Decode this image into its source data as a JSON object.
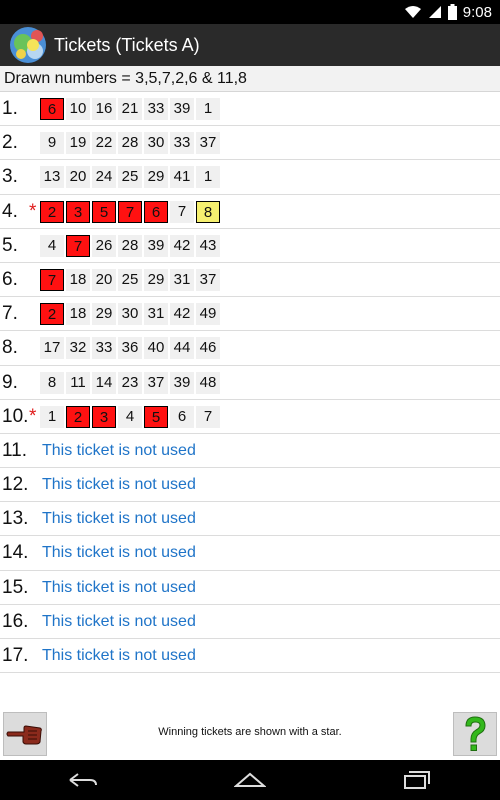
{
  "status": {
    "time": "9:08"
  },
  "header": {
    "title": "Tickets (Tickets A)"
  },
  "drawn": {
    "text": "Drawn numbers = 3,5,7,2,6 & 11,8"
  },
  "tickets": [
    {
      "label": "1.",
      "star": "",
      "numbers": [
        {
          "v": "6",
          "s": "hit"
        },
        {
          "v": "10",
          "s": ""
        },
        {
          "v": "16",
          "s": ""
        },
        {
          "v": "21",
          "s": ""
        },
        {
          "v": "33",
          "s": ""
        },
        {
          "v": "39",
          "s": ""
        },
        {
          "v": "1",
          "s": ""
        }
      ]
    },
    {
      "label": "2.",
      "star": "",
      "numbers": [
        {
          "v": "9",
          "s": ""
        },
        {
          "v": "19",
          "s": ""
        },
        {
          "v": "22",
          "s": ""
        },
        {
          "v": "28",
          "s": ""
        },
        {
          "v": "30",
          "s": ""
        },
        {
          "v": "33",
          "s": ""
        },
        {
          "v": "37",
          "s": ""
        }
      ]
    },
    {
      "label": "3.",
      "star": "",
      "numbers": [
        {
          "v": "13",
          "s": ""
        },
        {
          "v": "20",
          "s": ""
        },
        {
          "v": "24",
          "s": ""
        },
        {
          "v": "25",
          "s": ""
        },
        {
          "v": "29",
          "s": ""
        },
        {
          "v": "41",
          "s": ""
        },
        {
          "v": "1",
          "s": ""
        }
      ]
    },
    {
      "label": "4.",
      "star": "*",
      "numbers": [
        {
          "v": "2",
          "s": "hit"
        },
        {
          "v": "3",
          "s": "hit"
        },
        {
          "v": "5",
          "s": "hit"
        },
        {
          "v": "7",
          "s": "hit"
        },
        {
          "v": "6",
          "s": "hit"
        },
        {
          "v": "7",
          "s": ""
        },
        {
          "v": "8",
          "s": "bonus"
        }
      ]
    },
    {
      "label": "5.",
      "star": "",
      "numbers": [
        {
          "v": "4",
          "s": ""
        },
        {
          "v": "7",
          "s": "hit"
        },
        {
          "v": "26",
          "s": ""
        },
        {
          "v": "28",
          "s": ""
        },
        {
          "v": "39",
          "s": ""
        },
        {
          "v": "42",
          "s": ""
        },
        {
          "v": "43",
          "s": ""
        }
      ]
    },
    {
      "label": "6.",
      "star": "",
      "numbers": [
        {
          "v": "7",
          "s": "hit"
        },
        {
          "v": "18",
          "s": ""
        },
        {
          "v": "20",
          "s": ""
        },
        {
          "v": "25",
          "s": ""
        },
        {
          "v": "29",
          "s": ""
        },
        {
          "v": "31",
          "s": ""
        },
        {
          "v": "37",
          "s": ""
        }
      ]
    },
    {
      "label": "7.",
      "star": "",
      "numbers": [
        {
          "v": "2",
          "s": "hit"
        },
        {
          "v": "18",
          "s": ""
        },
        {
          "v": "29",
          "s": ""
        },
        {
          "v": "30",
          "s": ""
        },
        {
          "v": "31",
          "s": ""
        },
        {
          "v": "42",
          "s": ""
        },
        {
          "v": "49",
          "s": ""
        }
      ]
    },
    {
      "label": "8.",
      "star": "",
      "numbers": [
        {
          "v": "17",
          "s": ""
        },
        {
          "v": "32",
          "s": ""
        },
        {
          "v": "33",
          "s": ""
        },
        {
          "v": "36",
          "s": ""
        },
        {
          "v": "40",
          "s": ""
        },
        {
          "v": "44",
          "s": ""
        },
        {
          "v": "46",
          "s": ""
        }
      ]
    },
    {
      "label": "9.",
      "star": "",
      "numbers": [
        {
          "v": "8",
          "s": ""
        },
        {
          "v": "11",
          "s": ""
        },
        {
          "v": "14",
          "s": ""
        },
        {
          "v": "23",
          "s": ""
        },
        {
          "v": "37",
          "s": ""
        },
        {
          "v": "39",
          "s": ""
        },
        {
          "v": "48",
          "s": ""
        }
      ]
    },
    {
      "label": "10.",
      "star": "*",
      "numbers": [
        {
          "v": "1",
          "s": ""
        },
        {
          "v": "2",
          "s": "hit"
        },
        {
          "v": "3",
          "s": "hit"
        },
        {
          "v": "4",
          "s": ""
        },
        {
          "v": "5",
          "s": "hit"
        },
        {
          "v": "6",
          "s": ""
        },
        {
          "v": "7",
          "s": ""
        }
      ]
    },
    {
      "label": "11.",
      "star": "",
      "unused": "This ticket is not used"
    },
    {
      "label": "12.",
      "star": "",
      "unused": "This ticket is not used"
    },
    {
      "label": "13.",
      "star": "",
      "unused": "This ticket is not used"
    },
    {
      "label": "14.",
      "star": "",
      "unused": "This ticket is not used"
    },
    {
      "label": "15.",
      "star": "",
      "unused": "This ticket is not used"
    },
    {
      "label": "16.",
      "star": "",
      "unused": "This ticket is not used"
    },
    {
      "label": "17.",
      "star": "",
      "unused": "This ticket is not used"
    }
  ],
  "footer": {
    "hint": "Winning tickets are shown with a star.",
    "left_icon": "pointing-hand-icon",
    "right_icon": "question-mark-icon"
  },
  "colors": {
    "hit": "#ff1111",
    "bonus": "#f6f070",
    "link": "#1f74c8",
    "star": "#e01b1b"
  }
}
